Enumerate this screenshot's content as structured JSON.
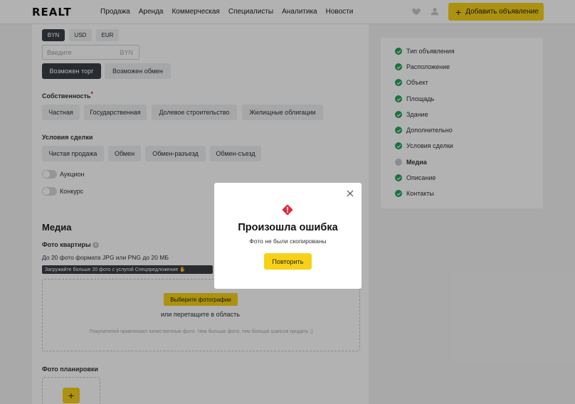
{
  "header": {
    "logo": "REALT",
    "nav": [
      "Продажа",
      "Аренда",
      "Коммерческая",
      "Специалисты",
      "Аналитика",
      "Новости"
    ],
    "add_button": "Добавить объявление"
  },
  "price": {
    "currencies": [
      "BYN",
      "USD",
      "EUR"
    ],
    "selected_currency": "BYN",
    "input_placeholder": "Введите",
    "input_unit": "BYN",
    "options": [
      "Возможен торг",
      "Возможен обмен"
    ]
  },
  "ownership": {
    "label": "Собственность",
    "required": "*",
    "options": [
      "Частная",
      "Государственная",
      "Долевое строительство",
      "Жилищные облигации"
    ]
  },
  "deal": {
    "label": "Условия сделки",
    "options": [
      "Чистая продажа",
      "Обмен",
      "Обмен-разъезд",
      "Обмен-съезд"
    ],
    "toggles": [
      "Аукцион",
      "Конкурс"
    ]
  },
  "media": {
    "title": "Медиа",
    "photos_label": "Фото квартиры",
    "photos_hint": "До 20 фото формата JPG или PNG до 20 МБ",
    "promo": "Загружайте больше 20 фото с услугой Спецпредложение",
    "choose_button": "Выберите фотографии",
    "or_drag": "или перетащите в область",
    "quality_hint": "Покупателей привлекают качественные фото. Чем больше фото, тем больше шансов продать ;)",
    "plans_label": "Фото планировки"
  },
  "steps": [
    {
      "label": "Тип объявления",
      "status": "done"
    },
    {
      "label": "Расположение",
      "status": "done"
    },
    {
      "label": "Объект",
      "status": "done"
    },
    {
      "label": "Площадь",
      "status": "done"
    },
    {
      "label": "Здание",
      "status": "done"
    },
    {
      "label": "Дополнительно",
      "status": "done"
    },
    {
      "label": "Условия сделки",
      "status": "done"
    },
    {
      "label": "Медиа",
      "status": "current"
    },
    {
      "label": "Описание",
      "status": "done"
    },
    {
      "label": "Контакты",
      "status": "done"
    }
  ],
  "modal": {
    "title": "Произошла ошибка",
    "message": "Фото не были скопированы",
    "retry": "Повторить"
  },
  "colors": {
    "accent": "#f7d117",
    "success": "#21a558",
    "error": "#e0293f",
    "dark_chip": "#3a3f47"
  }
}
